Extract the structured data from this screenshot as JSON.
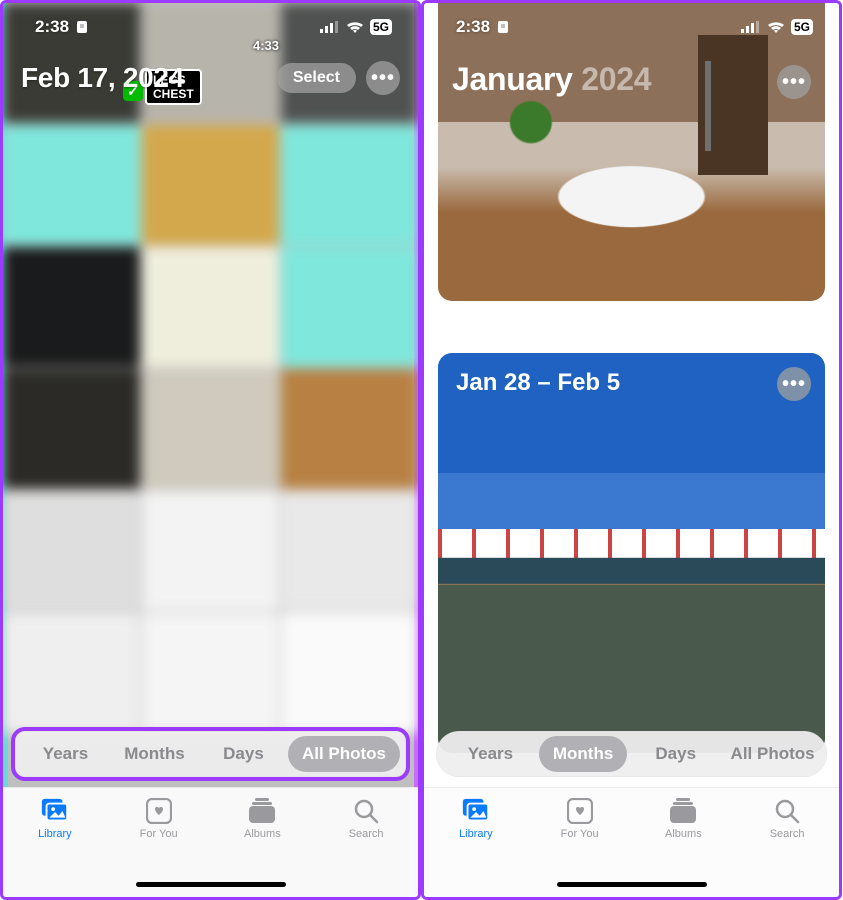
{
  "left": {
    "statusbar": {
      "time": "2:38",
      "cell": "5G"
    },
    "header": {
      "date": "Feb 17, 2024",
      "select_label": "Select"
    },
    "overlay": {
      "badge1": "LEGS",
      "badge2": "CHEST",
      "video_time": "4:33"
    },
    "scope": {
      "years": "Years",
      "months": "Months",
      "days": "Days",
      "all": "All Photos",
      "active": "all"
    },
    "tabs": {
      "library": "Library",
      "foryou": "For You",
      "albums": "Albums",
      "search": "Search",
      "active": "library"
    }
  },
  "right": {
    "statusbar": {
      "time": "2:38",
      "cell": "5G"
    },
    "month": {
      "name": "January",
      "year": "2024"
    },
    "week": {
      "range": "Jan 28 – Feb 5"
    },
    "scope": {
      "years": "Years",
      "months": "Months",
      "days": "Days",
      "all": "All Photos",
      "active": "months"
    },
    "tabs": {
      "library": "Library",
      "foryou": "For You",
      "albums": "Albums",
      "search": "Search",
      "active": "library"
    }
  }
}
